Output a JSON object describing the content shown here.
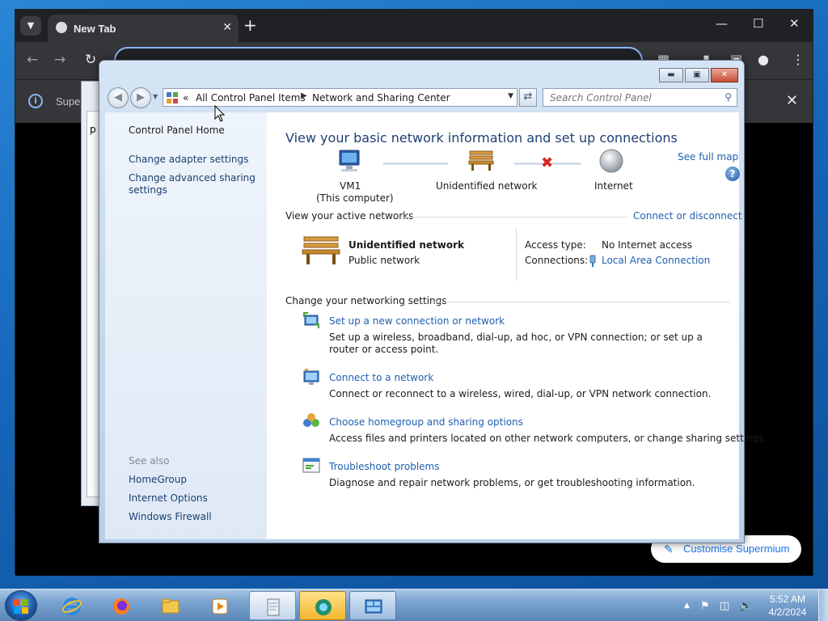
{
  "browser": {
    "tab_title": "New Tab",
    "info_text": "Supe",
    "customise_label": "Customise Supermium"
  },
  "bg_window": {
    "text": "p"
  },
  "address_bar": {
    "prefix": "«",
    "crumbs": [
      "All Control Panel Items",
      "Network and Sharing Center"
    ]
  },
  "search": {
    "placeholder": "Search Control Panel"
  },
  "left_pane": {
    "home": "Control Panel Home",
    "links": [
      "Change adapter settings",
      "Change advanced sharing settings"
    ],
    "see_also_title": "See also",
    "see_also": [
      "HomeGroup",
      "Internet Options",
      "Windows Firewall"
    ]
  },
  "main": {
    "title": "View your basic network information and set up connections",
    "see_full_map": "See full map",
    "map": {
      "computer_name": "VM1",
      "computer_sub": "(This computer)",
      "network": "Unidentified network",
      "internet": "Internet"
    },
    "active_networks_label": "View your active networks",
    "connect_disconnect": "Connect or disconnect",
    "active": {
      "name": "Unidentified network",
      "type": "Public network",
      "access_type_label": "Access type:",
      "access_type_value": "No Internet access",
      "connections_label": "Connections:",
      "connections_value": "Local Area Connection"
    },
    "change_settings_label": "Change your networking settings",
    "tasks": [
      {
        "title": "Set up a new connection or network",
        "desc": "Set up a wireless, broadband, dial-up, ad hoc, or VPN connection; or set up a router or access point."
      },
      {
        "title": "Connect to a network",
        "desc": "Connect or reconnect to a wireless, wired, dial-up, or VPN network connection."
      },
      {
        "title": "Choose homegroup and sharing options",
        "desc": "Access files and printers located on other network computers, or change sharing settings."
      },
      {
        "title": "Troubleshoot problems",
        "desc": "Diagnose and repair network problems, or get troubleshooting information."
      }
    ]
  },
  "taskbar": {
    "time": "5:52 AM",
    "date": "4/2/2024"
  }
}
